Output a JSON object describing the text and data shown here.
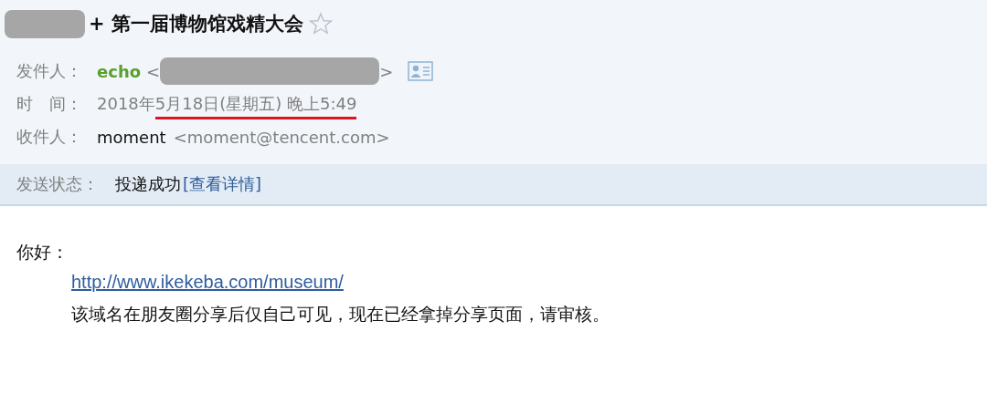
{
  "subject": {
    "title": "+ 第一届博物馆戏精大会",
    "starred": false
  },
  "sender": {
    "label": "发件人：",
    "name": "echo",
    "open": "<",
    "close": ">"
  },
  "time": {
    "label": "时　间：",
    "value": "2018年5月18日(星期五) 晚上5:49"
  },
  "recipient": {
    "label": "收件人：",
    "name": "moment",
    "address": "<moment@tencent.com>"
  },
  "status": {
    "label": "发送状态：",
    "value": "投递成功",
    "link": "[查看详情]"
  },
  "body": {
    "greeting": "你好：",
    "link": "http://www.ikekeba.com/museum/",
    "text": "该域名在朋友圈分享后仅自己可见，现在已经拿掉分享页面，请审核。"
  }
}
